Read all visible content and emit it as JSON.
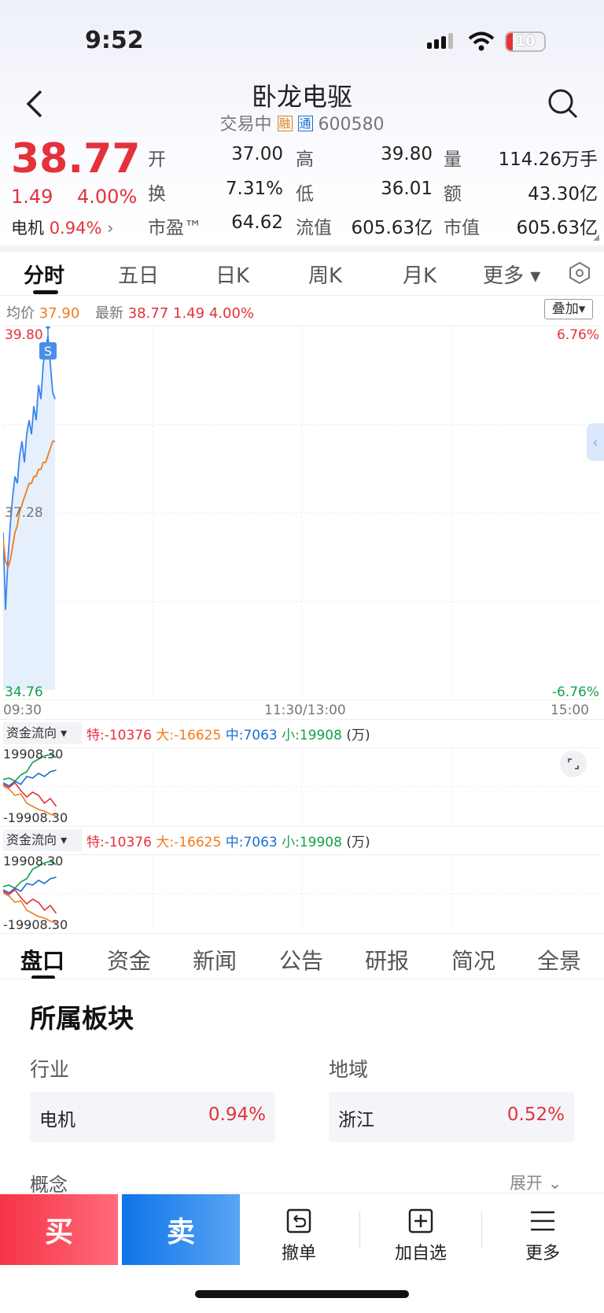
{
  "status_bar": {
    "time": "9:52",
    "battery": "10"
  },
  "header": {
    "title": "卧龙电驱",
    "status": "交易中",
    "badge_rong": "融",
    "badge_tong": "通",
    "code": "600580"
  },
  "quote": {
    "price": "38.77",
    "change": "1.49",
    "change_pct": "4.00%",
    "sector_name": "电机",
    "sector_pct": "0.94%",
    "open_label": "开",
    "open": "37.00",
    "high_label": "高",
    "high": "39.80",
    "volume_label": "量",
    "volume": "114.26万手",
    "turnover_label": "换",
    "turnover": "7.31%",
    "low_label": "低",
    "low": "36.01",
    "amount_label": "额",
    "amount": "43.30亿",
    "pe_label": "市盈™",
    "pe": "64.62",
    "float_cap_label": "流值",
    "float_cap": "605.63亿",
    "mkt_cap_label": "市值",
    "mkt_cap": "605.63亿"
  },
  "chart_tabs": [
    "分时",
    "五日",
    "日K",
    "周K",
    "月K",
    "更多 ▾"
  ],
  "chart_info": {
    "avg_label": "均价",
    "avg": "37.90",
    "latest_label": "最新",
    "latest": "38.77",
    "latest_change": "1.49",
    "latest_pct": "4.00%",
    "overlay_button": "叠加"
  },
  "chart_data": {
    "type": "line",
    "y_axis_left": [
      "39.80",
      "37.28",
      "34.76"
    ],
    "y_axis_right": [
      "6.76%",
      "-6.76%"
    ],
    "x_ticks": [
      "09:30",
      "11:30/13:00",
      "15:00"
    ],
    "ylim": [
      34.76,
      39.8
    ],
    "marker": "S",
    "series": [
      {
        "color": "#3a86f0",
        "values": [
          37.0,
          35.9,
          36.6,
          37.1,
          37.5,
          37.8,
          37.7,
          38.1,
          38.3,
          38.0,
          38.4,
          38.6,
          38.4,
          38.8,
          38.6,
          39.1,
          38.9,
          39.4,
          39.6,
          39.8,
          39.4,
          39.0,
          38.9
        ]
      },
      {
        "color": "#f07c1a",
        "values": [
          36.9,
          36.6,
          36.5,
          36.6,
          36.8,
          37.0,
          37.1,
          37.3,
          37.4,
          37.5,
          37.6,
          37.7,
          37.7,
          37.8,
          37.8,
          37.9,
          37.9,
          38.0,
          38.0,
          38.1,
          38.2,
          38.3,
          38.3
        ]
      }
    ]
  },
  "fund_flow": {
    "selector": "资金流向 ▾",
    "te": "特:-10376",
    "da": "大:-16625",
    "zhong": "中:7063",
    "xiao": "小:19908",
    "unit": "(万)",
    "ymax": "19908.30",
    "ymin": "-19908.30"
  },
  "bottom_tabs": [
    "盘口",
    "资金",
    "新闻",
    "公告",
    "研报",
    "简况",
    "全景"
  ],
  "sector": {
    "title": "所属板块",
    "industry_label": "行业",
    "region_label": "地域",
    "industry_name": "电机",
    "industry_pct": "0.94%",
    "region_name": "浙江",
    "region_pct": "0.52%",
    "concept_label": "概念",
    "expand_label": "展开"
  },
  "toolbar": {
    "buy": "买",
    "sell": "卖",
    "cancel": "撤单",
    "add_watch": "加自选",
    "more": "更多"
  }
}
